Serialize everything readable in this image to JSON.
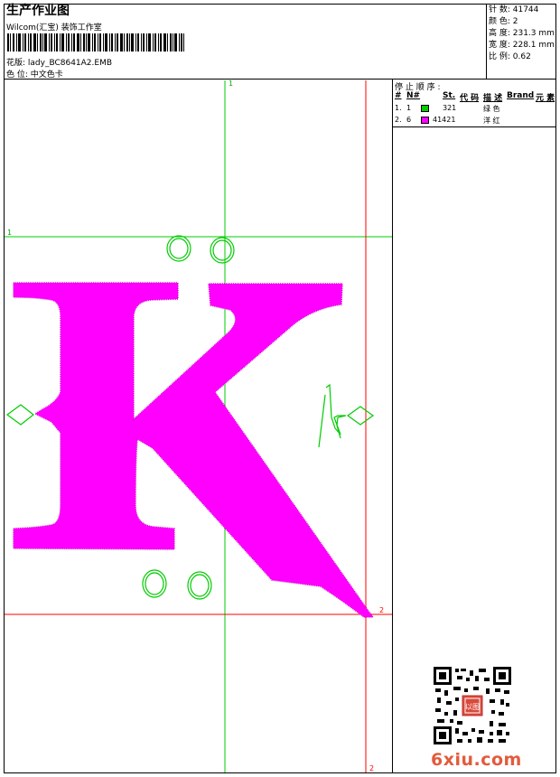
{
  "header": {
    "title": "生产作业图",
    "company": "Wilcom(汇宝) 装饰工作室",
    "design_label": "花版: lady_BC8641A2.EMB",
    "color_label": "色 位: 中文色卡"
  },
  "stats": {
    "stitches": "针 数: 41744",
    "colors": "颜 色: 2",
    "height": "高 度: 231.3 mm",
    "width": "宽 度: 228.1 mm",
    "scale": "比 例: 0.62"
  },
  "stop_sequence": {
    "title": "停 止 顺 序 :",
    "columns": [
      "#",
      "N#",
      "St.",
      "代 码",
      "描 述",
      "Brand",
      "元 素"
    ],
    "rows": [
      {
        "num": "1.",
        "n": "1",
        "color": "#00cc00",
        "st": "321",
        "desc": "绿 色"
      },
      {
        "num": "2.",
        "n": "6",
        "color": "#ff00ff",
        "st": "41421",
        "desc": "洋 红"
      }
    ]
  },
  "guides": {
    "v_green_label": "1",
    "h_green_label": "1",
    "v_red_label": "2",
    "h_red_label": "2"
  },
  "colors": {
    "green": "#00cc00",
    "magenta": "#ff00ff",
    "red_guide": "#ff0000"
  },
  "watermark": "6xiu.com",
  "qr_seal_text": "以图"
}
